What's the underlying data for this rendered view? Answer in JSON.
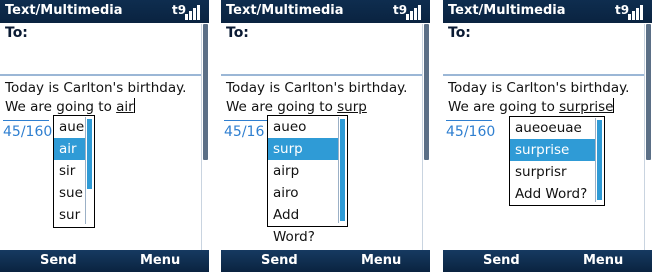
{
  "screens": [
    {
      "title": "Text/Multimedia",
      "status_t9": "t9",
      "to_label": "To:",
      "message_prefix": "Today is Carlton's birthday. We are going to ",
      "typed_word": "air",
      "char_count": "45/160",
      "suggestions": [
        "aue",
        "air",
        "sir",
        "sue",
        "sur"
      ],
      "selected_index": 1,
      "softkey_left": "Send",
      "softkey_right": "Menu"
    },
    {
      "title": "Text/Multimedia",
      "status_t9": "t9",
      "to_label": "To:",
      "message_prefix": "Today is Carlton's birthday. We are going to ",
      "typed_word": "surp",
      "char_count": "45/16",
      "suggestions": [
        "aueo",
        "surp",
        "airp",
        "airo",
        "Add Word?"
      ],
      "selected_index": 1,
      "softkey_left": "Send",
      "softkey_right": "Menu"
    },
    {
      "title": "Text/Multimedia",
      "status_t9": "t9",
      "to_label": "To:",
      "message_prefix": "Today is Carlton's birthday. We are going to ",
      "typed_word": "surprise",
      "char_count": "45/160",
      "suggestions": [
        "aueoeuae",
        "surprise",
        "surprisr",
        "Add Word?"
      ],
      "selected_index": 1,
      "softkey_left": "Send",
      "softkey_right": "Menu"
    }
  ],
  "colors": {
    "titlebar": "#0e2d4f",
    "selection": "#2f9bd6",
    "counter": "#2f7fd0"
  }
}
